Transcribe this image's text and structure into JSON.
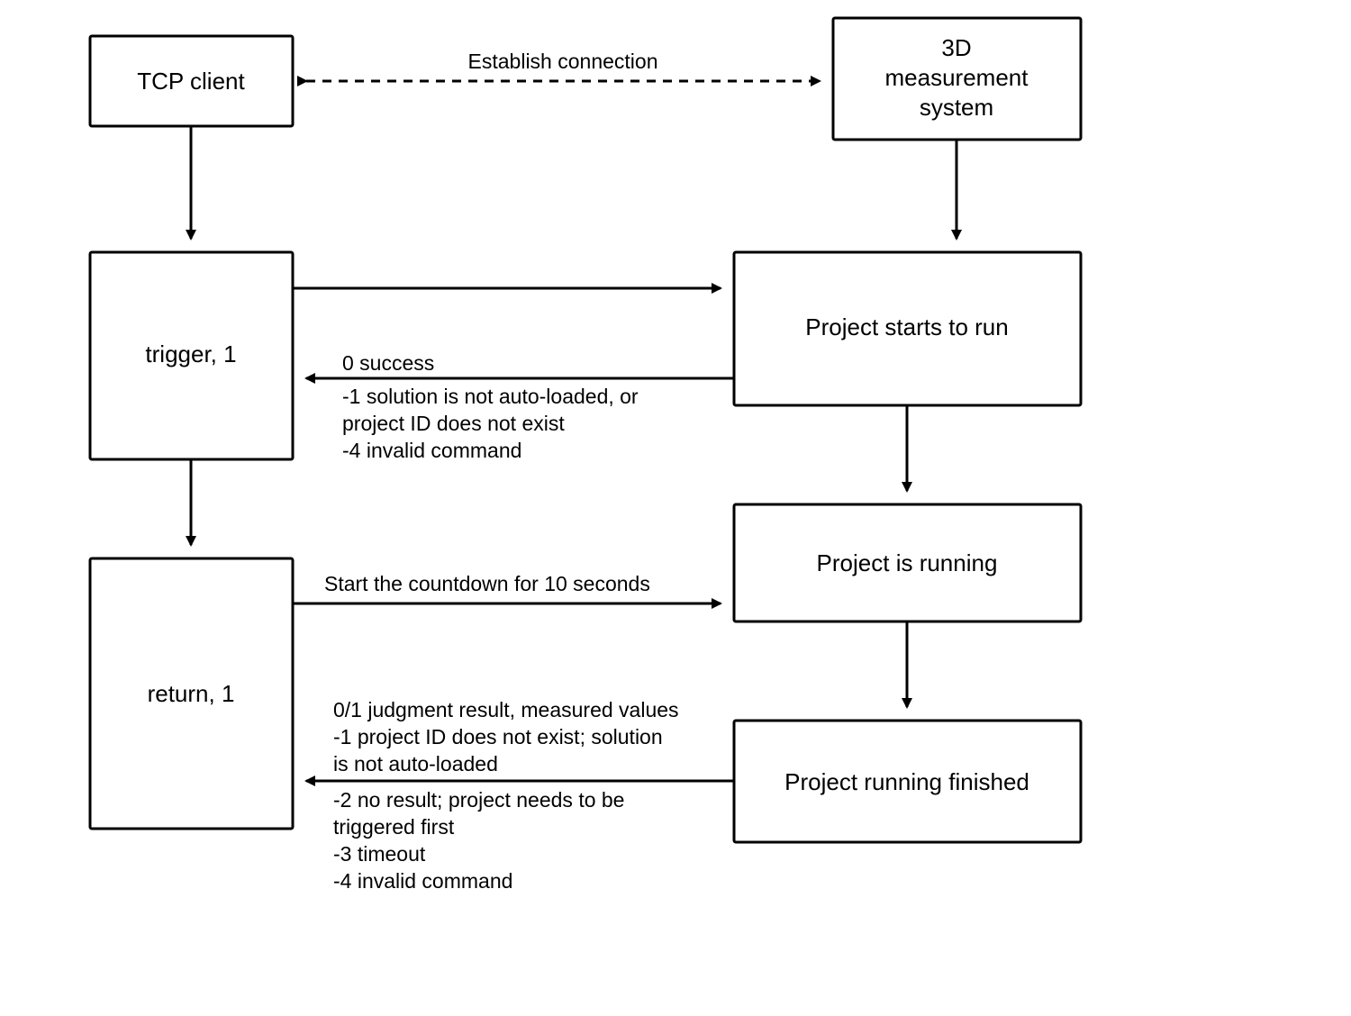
{
  "nodes": {
    "tcp_client": "TCP client",
    "measurement_system_l1": "3D",
    "measurement_system_l2": "measurement",
    "measurement_system_l3": "system",
    "trigger": "trigger, 1",
    "project_starts": "Project starts to run",
    "project_running": "Project is running",
    "return": "return, 1",
    "project_finished": "Project running finished"
  },
  "edges": {
    "establish": "Establish connection",
    "resp1_l1": "0 success",
    "resp1_l2": "-1 solution is not auto-loaded, or",
    "resp1_l3": "project ID does not exist",
    "resp1_l4": "-4 invalid command",
    "countdown": "Start the countdown for 10 seconds",
    "resp2_l1": " 0/1 judgment result, measured values",
    "resp2_l2": "-1    project ID does not exist; solution",
    "resp2_l3": "is not auto-loaded",
    "resp2_l4": "-2    no result; project needs to be",
    "resp2_l5": "triggered first",
    "resp2_l6": "-3    timeout",
    "resp2_l7": "-4    invalid command"
  }
}
